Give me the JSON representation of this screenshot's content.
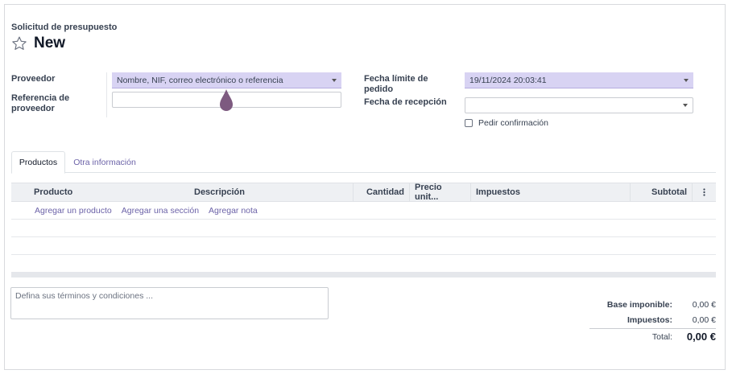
{
  "breadcrumb": "Solicitud de presupuesto",
  "title": "New",
  "form": {
    "proveedor_label": "Proveedor",
    "proveedor_placeholder": "Nombre, NIF, correo electrónico o referencia",
    "referencia_label": "Referencia de proveedor",
    "fecha_limite_label": "Fecha límite de pedido",
    "fecha_limite_value": "19/11/2024 20:03:41",
    "fecha_recepcion_label": "Fecha de recepción",
    "fecha_recepcion_value": "",
    "pedir_confirmacion_label": "Pedir confirmación"
  },
  "tabs": [
    {
      "label": "Productos",
      "active": true
    },
    {
      "label": "Otra información",
      "active": false
    }
  ],
  "table": {
    "columns": [
      "Producto",
      "Descripción",
      "Cantidad",
      "Precio unit...",
      "Impuestos",
      "Subtotal"
    ],
    "options_icon": "kebab-menu-icon",
    "add_links": [
      "Agregar un producto",
      "Agregar una sección",
      "Agregar nota"
    ]
  },
  "terms_placeholder": "Defina sus términos y condiciones ...",
  "totals": {
    "base_label": "Base imponible:",
    "base_value": "0,00 €",
    "taxes_label": "Impuestos:",
    "taxes_value": "0,00 €",
    "total_label": "Total:",
    "total_value": "0,00 €"
  },
  "colors": {
    "accent": "#6c63a8",
    "selection_field": "#d8d3f3",
    "drag_cursor": "#7d5a80"
  },
  "icons": [
    "star-icon",
    "chevron-down-icon",
    "drop-cursor-icon",
    "kebab-menu-icon"
  ]
}
